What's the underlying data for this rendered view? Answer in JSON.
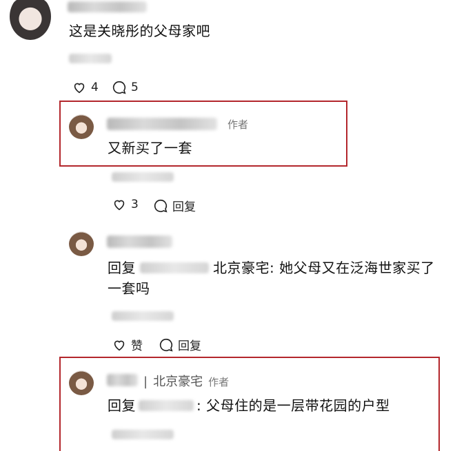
{
  "comment1": {
    "text": "这是关晓彤的父母家吧",
    "like_count": "4",
    "reply_count": "5"
  },
  "reply1": {
    "author_tag": "作者",
    "text": "又新买了一套",
    "like_count": "3",
    "reply_label": "回复"
  },
  "reply2": {
    "reply_prefix": "回复",
    "text_after_name": "北京豪宅: 她父母又在泛海世家买了",
    "text_line2": "一套吗",
    "like_label": "赞",
    "reply_label": "回复"
  },
  "reply3": {
    "author_separator": "|",
    "author_name": "北京豪宅",
    "author_tag": "作者",
    "reply_prefix": "回复",
    "text": ": 父母住的是一层带花园的户型"
  },
  "colors": {
    "highlight_border": "#b3262b",
    "text": "#111111",
    "muted": "#777777"
  },
  "icons": [
    "heart-icon",
    "comment-icon"
  ]
}
